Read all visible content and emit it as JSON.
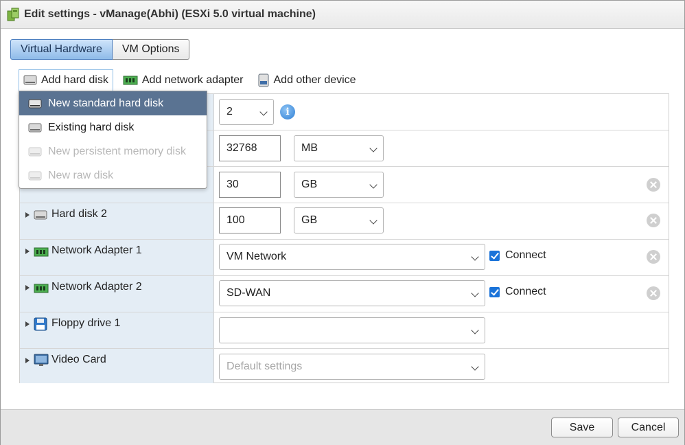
{
  "dialog": {
    "title": "Edit settings - vManage(Abhi) (ESXi 5.0 virtual machine)"
  },
  "tabs": [
    {
      "label": "Virtual Hardware",
      "active": true
    },
    {
      "label": "VM Options",
      "active": false
    }
  ],
  "toolbar": {
    "add_hard_disk": "Add hard disk",
    "add_network_adapter": "Add network adapter",
    "add_other_device": "Add other device"
  },
  "dropdown": {
    "items": [
      {
        "label": "New standard hard disk",
        "state": "selected"
      },
      {
        "label": "Existing hard disk",
        "state": "enabled"
      },
      {
        "label": "New persistent memory disk",
        "state": "disabled"
      },
      {
        "label": "New raw disk",
        "state": "disabled"
      }
    ]
  },
  "hardware": {
    "cpu": {
      "value": "2"
    },
    "memory": {
      "value": "32768",
      "unit": "MB"
    },
    "hard_disk_1": {
      "value": "30",
      "unit": "GB"
    },
    "hard_disk_2": {
      "label": "Hard disk 2",
      "value": "100",
      "unit": "GB"
    },
    "network_adapter_1": {
      "label": "Network Adapter 1",
      "network": "VM Network",
      "connect_label": "Connect",
      "connected": true
    },
    "network_adapter_2": {
      "label": "Network Adapter 2",
      "network": "SD-WAN",
      "connect_label": "Connect",
      "connected": true
    },
    "floppy_drive_1": {
      "label": "Floppy drive 1",
      "value": ""
    },
    "video_card": {
      "label": "Video Card",
      "value": "Default settings"
    }
  },
  "footer": {
    "save_label": "Save",
    "cancel_label": "Cancel"
  },
  "colors": {
    "label_column_bg": "#e4edf5",
    "selected_item_bg": "#5a7392",
    "checkbox_blue": "#1a73d9",
    "active_tab_blue": "#8fbbe9"
  }
}
